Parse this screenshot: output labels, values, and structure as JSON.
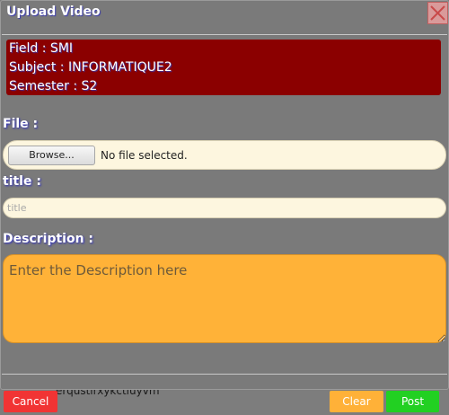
{
  "dialog": {
    "title": "Upload Video",
    "close_icon": "close-x-icon"
  },
  "info": {
    "field": "Field  : SMI",
    "subject": "Subject  : INFORMATIQUE2",
    "semester": "Semester  : S2"
  },
  "file": {
    "label": "File :",
    "browse_label": "Browse...",
    "status": "No file selected."
  },
  "title_field": {
    "label": "title :",
    "placeholder": "title",
    "value": ""
  },
  "description": {
    "label": "Description :",
    "placeholder": "Enter the Description here",
    "value": ""
  },
  "buttons": {
    "cancel": "Cancel",
    "clear": "Clear",
    "post": "Post"
  },
  "background_text": "erqustirxykctiuyvm",
  "colors": {
    "info_bg": "#8b0000",
    "description_bg": "#ffb238",
    "cancel": "#f13434",
    "clear": "#ffb138",
    "post": "#22d022"
  }
}
